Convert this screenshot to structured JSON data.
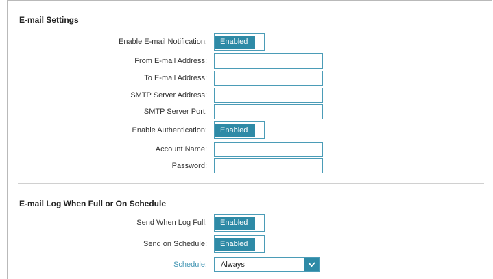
{
  "email_settings": {
    "title": "E-mail Settings",
    "enable_notification": {
      "label": "Enable E-mail Notification:",
      "state": "Enabled"
    },
    "from_address": {
      "label": "From E-mail Address:",
      "value": ""
    },
    "to_address": {
      "label": "To E-mail Address:",
      "value": ""
    },
    "smtp_server": {
      "label": "SMTP Server Address:",
      "value": ""
    },
    "smtp_port": {
      "label": "SMTP Server Port:",
      "value": ""
    },
    "enable_auth": {
      "label": "Enable Authentication:",
      "state": "Enabled"
    },
    "account_name": {
      "label": "Account Name:",
      "value": ""
    },
    "password": {
      "label": "Password:",
      "value": ""
    }
  },
  "log_settings": {
    "title": "E-mail Log When Full or On Schedule",
    "send_when_full": {
      "label": "Send When Log Full:",
      "state": "Enabled"
    },
    "send_on_schedule": {
      "label": "Send on Schedule:",
      "state": "Enabled"
    },
    "schedule": {
      "label": "Schedule:",
      "value": "Always"
    }
  },
  "colors": {
    "accent": "#2e8aa6",
    "border": "#4b9cb7",
    "link": "#4597b4"
  },
  "icons": {
    "schedule_dropdown": "chevron-down-icon"
  }
}
